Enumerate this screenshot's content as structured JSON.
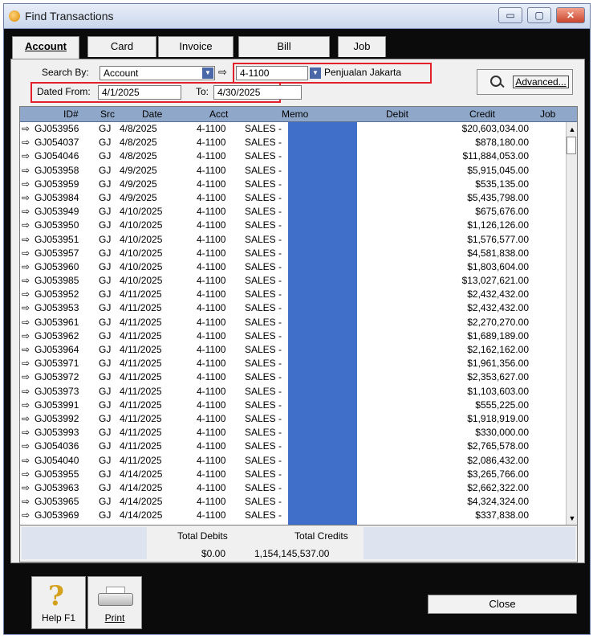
{
  "window": {
    "title": "Find Transactions",
    "min_glyph": "▭",
    "max_glyph": "▢",
    "close_glyph": "✕"
  },
  "tabs": [
    {
      "label": "Account",
      "active": true
    },
    {
      "label": "Card"
    },
    {
      "label": "Invoice"
    },
    {
      "label": "Bill"
    },
    {
      "label": "Job"
    }
  ],
  "search": {
    "search_by_label": "Search By:",
    "search_by_value": "Account",
    "arrow": "⇨",
    "account_number": "4-1100",
    "account_name": "Penjualan Jakarta",
    "dated_from_label": "Dated From:",
    "dated_from_value": "4/1/2025",
    "to_label": "To:",
    "to_value": "4/30/2025",
    "advanced_label": "Advanced..."
  },
  "grid": {
    "headers": {
      "id": "ID#",
      "src": "Src",
      "date": "Date",
      "acct": "Acct",
      "memo": "Memo",
      "debit": "Debit",
      "credit": "Credit",
      "job": "Job"
    },
    "rows": [
      {
        "id": "GJ053956",
        "src": "GJ",
        "date": "4/8/2025",
        "acct": "4-1100",
        "memo": "SALES -",
        "credit": "$20,603,034.00"
      },
      {
        "id": "GJ054037",
        "src": "GJ",
        "date": "4/8/2025",
        "acct": "4-1100",
        "memo": "SALES -",
        "credit": "$878,180.00"
      },
      {
        "id": "GJ054046",
        "src": "GJ",
        "date": "4/8/2025",
        "acct": "4-1100",
        "memo": "SALES -",
        "credit": "$11,884,053.00"
      },
      {
        "id": "GJ053958",
        "src": "GJ",
        "date": "4/9/2025",
        "acct": "4-1100",
        "memo": "SALES -",
        "credit": "$5,915,045.00"
      },
      {
        "id": "GJ053959",
        "src": "GJ",
        "date": "4/9/2025",
        "acct": "4-1100",
        "memo": "SALES -",
        "credit": "$535,135.00"
      },
      {
        "id": "GJ053984",
        "src": "GJ",
        "date": "4/9/2025",
        "acct": "4-1100",
        "memo": "SALES -",
        "credit": "$5,435,798.00"
      },
      {
        "id": "GJ053949",
        "src": "GJ",
        "date": "4/10/2025",
        "acct": "4-1100",
        "memo": "SALES -",
        "credit": "$675,676.00"
      },
      {
        "id": "GJ053950",
        "src": "GJ",
        "date": "4/10/2025",
        "acct": "4-1100",
        "memo": "SALES -",
        "credit": "$1,126,126.00"
      },
      {
        "id": "GJ053951",
        "src": "GJ",
        "date": "4/10/2025",
        "acct": "4-1100",
        "memo": "SALES -",
        "credit": "$1,576,577.00"
      },
      {
        "id": "GJ053957",
        "src": "GJ",
        "date": "4/10/2025",
        "acct": "4-1100",
        "memo": "SALES -",
        "credit": "$4,581,838.00"
      },
      {
        "id": "GJ053960",
        "src": "GJ",
        "date": "4/10/2025",
        "acct": "4-1100",
        "memo": "SALES -",
        "credit": "$1,803,604.00"
      },
      {
        "id": "GJ053985",
        "src": "GJ",
        "date": "4/10/2025",
        "acct": "4-1100",
        "memo": "SALES -",
        "credit": "$13,027,621.00"
      },
      {
        "id": "GJ053952",
        "src": "GJ",
        "date": "4/11/2025",
        "acct": "4-1100",
        "memo": "SALES -",
        "credit": "$2,432,432.00"
      },
      {
        "id": "GJ053953",
        "src": "GJ",
        "date": "4/11/2025",
        "acct": "4-1100",
        "memo": "SALES -",
        "credit": "$2,432,432.00"
      },
      {
        "id": "GJ053961",
        "src": "GJ",
        "date": "4/11/2025",
        "acct": "4-1100",
        "memo": "SALES -",
        "credit": "$2,270,270.00"
      },
      {
        "id": "GJ053962",
        "src": "GJ",
        "date": "4/11/2025",
        "acct": "4-1100",
        "memo": "SALES -",
        "credit": "$1,689,189.00"
      },
      {
        "id": "GJ053964",
        "src": "GJ",
        "date": "4/11/2025",
        "acct": "4-1100",
        "memo": "SALES -",
        "credit": "$2,162,162.00"
      },
      {
        "id": "GJ053971",
        "src": "GJ",
        "date": "4/11/2025",
        "acct": "4-1100",
        "memo": "SALES -",
        "credit": "$1,961,356.00"
      },
      {
        "id": "GJ053972",
        "src": "GJ",
        "date": "4/11/2025",
        "acct": "4-1100",
        "memo": "SALES -",
        "credit": "$2,353,627.00"
      },
      {
        "id": "GJ053973",
        "src": "GJ",
        "date": "4/11/2025",
        "acct": "4-1100",
        "memo": "SALES -",
        "credit": "$1,103,603.00"
      },
      {
        "id": "GJ053991",
        "src": "GJ",
        "date": "4/11/2025",
        "acct": "4-1100",
        "memo": "SALES -",
        "credit": "$555,225.00"
      },
      {
        "id": "GJ053992",
        "src": "GJ",
        "date": "4/11/2025",
        "acct": "4-1100",
        "memo": "SALES -",
        "credit": "$1,918,919.00"
      },
      {
        "id": "GJ053993",
        "src": "GJ",
        "date": "4/11/2025",
        "acct": "4-1100",
        "memo": "SALES -",
        "credit": "$330,000.00"
      },
      {
        "id": "GJ054036",
        "src": "GJ",
        "date": "4/11/2025",
        "acct": "4-1100",
        "memo": "SALES -",
        "credit": "$2,765,578.00"
      },
      {
        "id": "GJ054040",
        "src": "GJ",
        "date": "4/11/2025",
        "acct": "4-1100",
        "memo": "SALES -",
        "credit": "$2,086,432.00"
      },
      {
        "id": "GJ053955",
        "src": "GJ",
        "date": "4/14/2025",
        "acct": "4-1100",
        "memo": "SALES -",
        "credit": "$3,265,766.00"
      },
      {
        "id": "GJ053963",
        "src": "GJ",
        "date": "4/14/2025",
        "acct": "4-1100",
        "memo": "SALES -",
        "credit": "$2,662,322.00"
      },
      {
        "id": "GJ053965",
        "src": "GJ",
        "date": "4/14/2025",
        "acct": "4-1100",
        "memo": "SALES -",
        "credit": "$4,324,324.00"
      },
      {
        "id": "GJ053969",
        "src": "GJ",
        "date": "4/14/2025",
        "acct": "4-1100",
        "memo": "SALES -",
        "credit": "$337,838.00"
      }
    ]
  },
  "totals": {
    "debits_label": "Total Debits",
    "debits_value": "$0.00",
    "credits_label": "Total Credits",
    "credits_value": "1,154,145,537.00"
  },
  "footer": {
    "help_label": "Help F1",
    "print_label": "Print",
    "close_label": "Close"
  },
  "colors": {
    "memo_fill": "#3f6fc8",
    "highlight": "#e0202a",
    "header_bg": "#8fa7c9"
  }
}
